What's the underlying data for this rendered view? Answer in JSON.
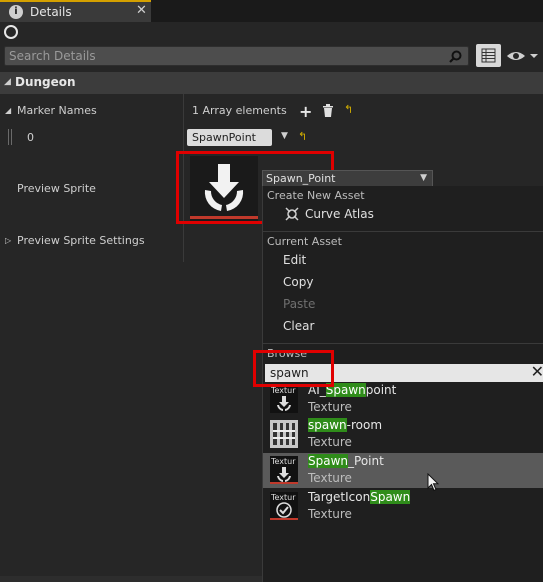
{
  "tab": {
    "icon": "info-icon",
    "label": "Details",
    "close": "✕"
  },
  "search": {
    "placeholder": "Search Details",
    "value": ""
  },
  "category": {
    "title": "Dungeon"
  },
  "marker_names": {
    "label": "Marker Names",
    "count_text": "1 Array elements",
    "index": "0",
    "value": "SpawnPoint"
  },
  "preview_sprite": {
    "label": "Preview Sprite",
    "asset_value": "Spawn_Point"
  },
  "preview_sprite_settings": {
    "label": "Preview Sprite Settings"
  },
  "dropdown": {
    "create_new_asset_title": "Create New Asset",
    "curve_atlas": "Curve Atlas",
    "current_asset_title": "Current Asset",
    "edit": "Edit",
    "copy": "Copy",
    "paste": "Paste",
    "clear": "Clear",
    "browse_title": "Browse",
    "filter_value": "spawn",
    "assets": [
      {
        "pre": "AI_",
        "match": "Spawn",
        "post": "point",
        "type": "Texture",
        "thumb_label": "Textur"
      },
      {
        "pre": "",
        "match": "spawn",
        "post": "-room",
        "type": "Texture",
        "thumb_label": ""
      },
      {
        "pre": "",
        "match": "Spawn",
        "post": "_Point",
        "type": "Texture",
        "thumb_label": "Textur"
      },
      {
        "pre": "TargetIcon",
        "match": "Spawn",
        "post": "",
        "type": "Texture",
        "thumb_label": "Textur"
      }
    ]
  },
  "colors": {
    "highlight_box": "#e00000",
    "match_highlight": "#2f8c1a",
    "tab_accent": "#d4a000"
  }
}
